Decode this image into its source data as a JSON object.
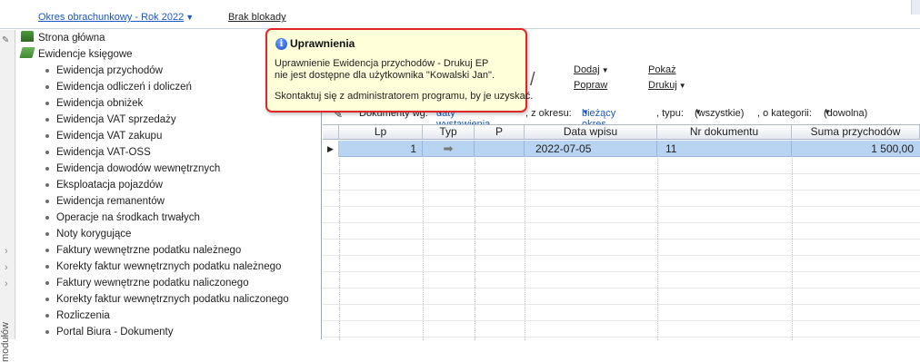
{
  "topbar": {
    "period_label": "Okres obrachunkowy - Rok 2022",
    "block_label": "Brak blokady"
  },
  "sidebar": {
    "vertical_label": "modułów",
    "items": [
      {
        "label": "Strona główna",
        "icon": "home-icon",
        "level": 0
      },
      {
        "label": "Ewidencje księgowe",
        "icon": "book-icon",
        "level": 0
      },
      {
        "label": "Ewidencja przychodów",
        "level": 1
      },
      {
        "label": "Ewidencja odliczeń i doliczeń",
        "level": 1
      },
      {
        "label": "Ewidencja obniżek",
        "level": 1
      },
      {
        "label": "Ewidencja VAT sprzedaży",
        "level": 1
      },
      {
        "label": "Ewidencja VAT zakupu",
        "level": 1
      },
      {
        "label": "Ewidencja VAT-OSS",
        "level": 1
      },
      {
        "label": "Ewidencja dowodów wewnętrznych",
        "level": 1
      },
      {
        "label": "Eksploatacja pojazdów",
        "level": 1
      },
      {
        "label": "Ewidencja remanentów",
        "level": 1
      },
      {
        "label": "Operacje na środkach trwałych",
        "level": 1
      },
      {
        "label": "Noty korygujące",
        "level": 1
      },
      {
        "label": "Faktury wewnętrzne podatku należnego",
        "level": 1
      },
      {
        "label": "Korekty faktur wewnętrznych podatku należnego",
        "level": 1
      },
      {
        "label": "Faktury wewnętrzne podatku naliczonego",
        "level": 1
      },
      {
        "label": "Korekty faktur wewnętrznych podatku naliczonego",
        "level": 1
      },
      {
        "label": "Rozliczenia",
        "level": 1
      },
      {
        "label": "Portal Biura - Dokumenty",
        "level": 1
      }
    ]
  },
  "toolbar": {
    "add_label": "Dodaj",
    "edit_label": "Popraw",
    "show_label": "Pokaż",
    "print_label": "Drukuj"
  },
  "filter": {
    "documents_by_label": "Dokumenty wg:",
    "documents_by_value": "daty wystawienia",
    "period_label": ", z okresu:",
    "period_value": "bieżący okres",
    "type_label": ", typu:",
    "type_value": "(wszystkie)",
    "category_label": ", o kategorii:",
    "category_value": "(dowolna)"
  },
  "grid": {
    "columns": [
      "Lp",
      "Typ",
      "P",
      "Data wpisu",
      "Nr dokumentu",
      "Suma przychodów"
    ],
    "rows": [
      {
        "lp": "1",
        "typ": "arrow-right-icon",
        "p": "",
        "data": "2022-07-05",
        "nr": "11",
        "suma": "1 500,00"
      }
    ]
  },
  "popup": {
    "title": "Uprawnienia",
    "line1": "Uprawnienie Ewidencja przychodów - Drukuj EP",
    "line2": "nie jest dostępne dla użytkownika \"Kowalski Jan\".",
    "line3": "Skontaktuj się z administratorem programu, by je uzyskać."
  },
  "colors": {
    "accent_link": "#1a56c4",
    "popup_border": "#e0262b",
    "popup_bg": "#ffffd9",
    "selected_row": "#b8d4f2"
  }
}
